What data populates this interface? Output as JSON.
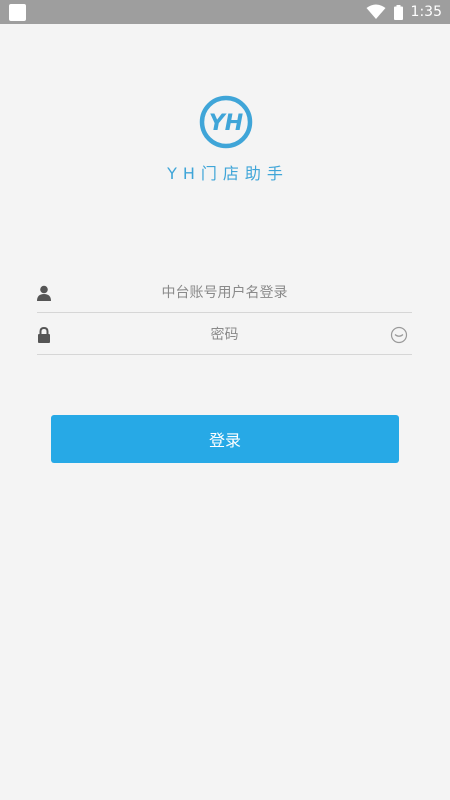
{
  "status_bar": {
    "time": "1:35",
    "icons": [
      "notification-square-icon",
      "wifi-icon",
      "battery-icon"
    ]
  },
  "app": {
    "logo_text": "YH",
    "name": "YH门店助手",
    "brand_color": "#3fa5d8"
  },
  "login_form": {
    "username": {
      "icon": "user-icon",
      "placeholder": "中台账号用户名登录",
      "value": ""
    },
    "password": {
      "icon": "lock-icon",
      "placeholder": "密码",
      "value": "",
      "toggle_icon": "eye-closed-icon"
    },
    "submit_label": "登录",
    "button_color": "#27a9e6"
  }
}
